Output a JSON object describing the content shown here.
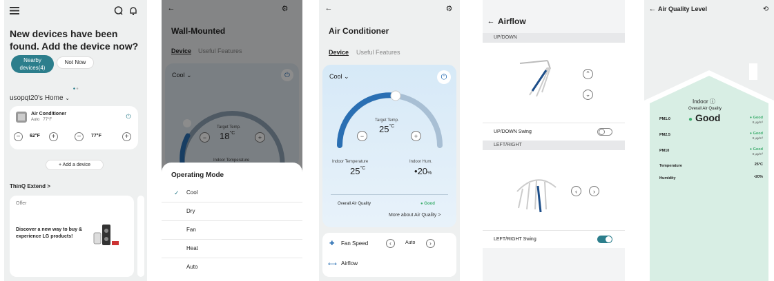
{
  "home": {
    "headline": "New devices have been found. Add the device now?",
    "nearby_button": "Nearby devices(4)",
    "notnow_button": "Not Now",
    "home_name": "usopqt20's Home",
    "device_name": "Air Conditioner",
    "device_mode": "Auto",
    "device_temp": "77°F",
    "temp1": "62°F",
    "temp2": "77°F",
    "add_device": "+ Add a device",
    "thinq_extend": "ThinQ Extend >",
    "offer_label": "Offer",
    "offer_text": "Discover a new way to buy & experience LG products!"
  },
  "wall": {
    "title": "Wall-Mounted",
    "tab_device": "Device",
    "tab_useful": "Useful Features",
    "mode": "Cool",
    "target_label": "Target Temp.",
    "target_value": "18",
    "target_unit": "°C",
    "indoor_partial": "Indoor Temperature",
    "sheet_title": "Operating Mode",
    "options": [
      "Cool",
      "Dry",
      "Fan",
      "Heat",
      "Auto"
    ],
    "selected_index": 0
  },
  "ac": {
    "title": "Air Conditioner",
    "tab_device": "Device",
    "tab_useful": "Useful Features",
    "mode": "Cool",
    "target_label": "Target Temp.",
    "target_value": "25",
    "target_unit": "°C",
    "indoor_temp_label": "Indoor Temperature",
    "indoor_temp_value": "25",
    "indoor_temp_unit": "°C",
    "indoor_hum_label": "Indoor Hum.",
    "indoor_hum_value": "20",
    "indoor_hum_unit": "%",
    "aq_label": "Overall Air Quality",
    "aq_value": "● Good",
    "more_aq": "More about Air Quality >",
    "fan_speed_label": "Fan Speed",
    "fan_speed_value": "Auto",
    "airflow_label": "Airflow"
  },
  "airflow": {
    "title": "Airflow",
    "updown_header": "UP/DOWN",
    "updown_swing": "UP/DOWN Swing",
    "updown_swing_on": false,
    "leftright_header": "LEFT/RIGHT",
    "leftright_swing": "LEFT/RIGHT Swing",
    "leftright_swing_on": true
  },
  "aq": {
    "title": "Air Quality Level",
    "indoor": "Indoor",
    "overall": "Overall Air Quality",
    "overall_value": "Good",
    "rows": [
      {
        "label": "PM1.0",
        "value": "● Good",
        "sub": "8 µg/m³"
      },
      {
        "label": "PM2.5",
        "value": "● Good",
        "sub": "8 µg/m³"
      },
      {
        "label": "PM10",
        "value": "● Good",
        "sub": "8 µg/m³"
      },
      {
        "label": "Temperature",
        "value": "25°C",
        "sub": ""
      },
      {
        "label": "Humidity",
        "value": "•20%",
        "sub": ""
      }
    ]
  },
  "colors": {
    "accent_teal": "#2c7e8c",
    "good_green": "#3fae6f",
    "arc_blue": "#2a6fb3",
    "aq_bg": "#d8eee4"
  }
}
